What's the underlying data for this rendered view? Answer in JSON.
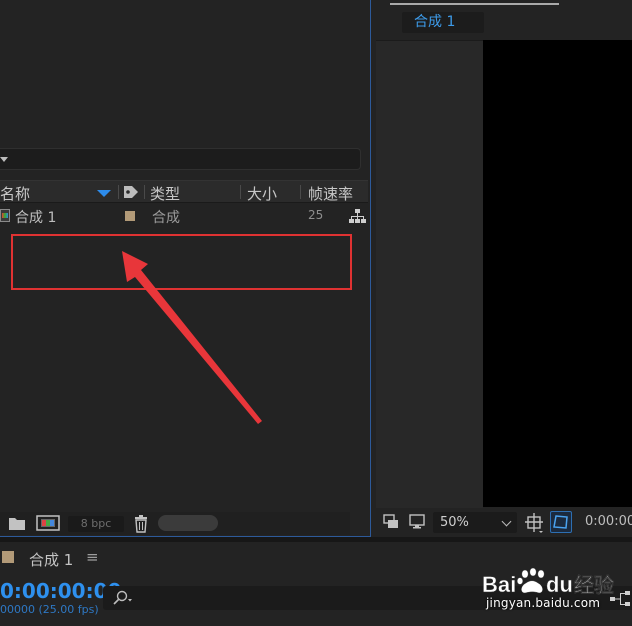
{
  "project": {
    "columns": {
      "name": "名称",
      "type": "类型",
      "size": "大小",
      "fps": "帧速率"
    },
    "rows": [
      {
        "name": "合成 1",
        "type": "合成",
        "fps": "25"
      }
    ],
    "bit_depth": "8 bpc",
    "label_color": "#b29a78"
  },
  "composition": {
    "tab": "合成 1",
    "zoom": "50%",
    "timecode": "0:00:00"
  },
  "timeline": {
    "title": "合成 1",
    "menu_icon": "≡",
    "timecode": "0:00:00:00",
    "frame_info": "00000 (25.00 fps)"
  },
  "watermark": {
    "logo": "Baidu经验",
    "site": "jingyan.baidu.com"
  },
  "colors": {
    "accent": "#2e90ee",
    "annotation": "#e03232"
  }
}
